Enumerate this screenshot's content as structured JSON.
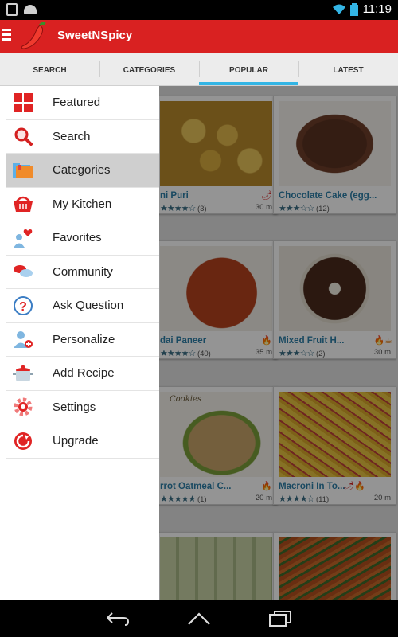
{
  "status_bar": {
    "time": "11:19"
  },
  "app_bar": {
    "title": "SweetNSpicy"
  },
  "tabs": [
    {
      "label": "SEARCH",
      "active": false
    },
    {
      "label": "CATEGORIES",
      "active": false
    },
    {
      "label": "POPULAR",
      "active": true
    },
    {
      "label": "LATEST",
      "active": false
    }
  ],
  "drawer": {
    "items": [
      {
        "label": "Featured",
        "icon": "featured-grid-icon",
        "active": false
      },
      {
        "label": "Search",
        "icon": "search-icon",
        "active": false
      },
      {
        "label": "Categories",
        "icon": "folder-icon",
        "active": true
      },
      {
        "label": "My Kitchen",
        "icon": "basket-icon",
        "active": false
      },
      {
        "label": "Favorites",
        "icon": "favorites-heart-icon",
        "active": false
      },
      {
        "label": "Community",
        "icon": "chat-bubbles-icon",
        "active": false
      },
      {
        "label": "Ask Question",
        "icon": "question-icon",
        "active": false
      },
      {
        "label": "Personalize",
        "icon": "personalize-user-icon",
        "active": false
      },
      {
        "label": "Add Recipe",
        "icon": "cooking-pot-icon",
        "active": false
      },
      {
        "label": "Settings",
        "icon": "gear-icon",
        "active": false
      },
      {
        "label": "Upgrade",
        "icon": "upgrade-icon",
        "active": false
      }
    ]
  },
  "recipes": [
    {
      "name": "ni Puri",
      "rating_count": "(3)",
      "time": "30 m",
      "stars": 4,
      "flag": "chili"
    },
    {
      "name": "Chocolate Cake (egg...",
      "rating_count": "(12)",
      "time": "",
      "stars": 3,
      "flag": ""
    },
    {
      "name": "dai Paneer",
      "rating_count": "(40)",
      "time": "35 m",
      "stars": 4,
      "flag": "fire"
    },
    {
      "name": "Mixed Fruit H...",
      "rating_count": "(2)",
      "time": "30 m",
      "stars": 3,
      "flag": "fire-cup"
    },
    {
      "name": "rrot Oatmeal C...",
      "rating_count": "(1)",
      "time": "20 m",
      "stars": 5,
      "flag": "fire"
    },
    {
      "name": "Macroni In To...",
      "rating_count": "(11)",
      "time": "20 m",
      "stars": 4,
      "flag": "chili-fire"
    }
  ],
  "card_image_labels": {
    "cookies": "Cookies"
  },
  "colors": {
    "brand_red": "#d92121",
    "tab_indicator": "#33b5e5",
    "link_blue": "#2c7ea8"
  }
}
